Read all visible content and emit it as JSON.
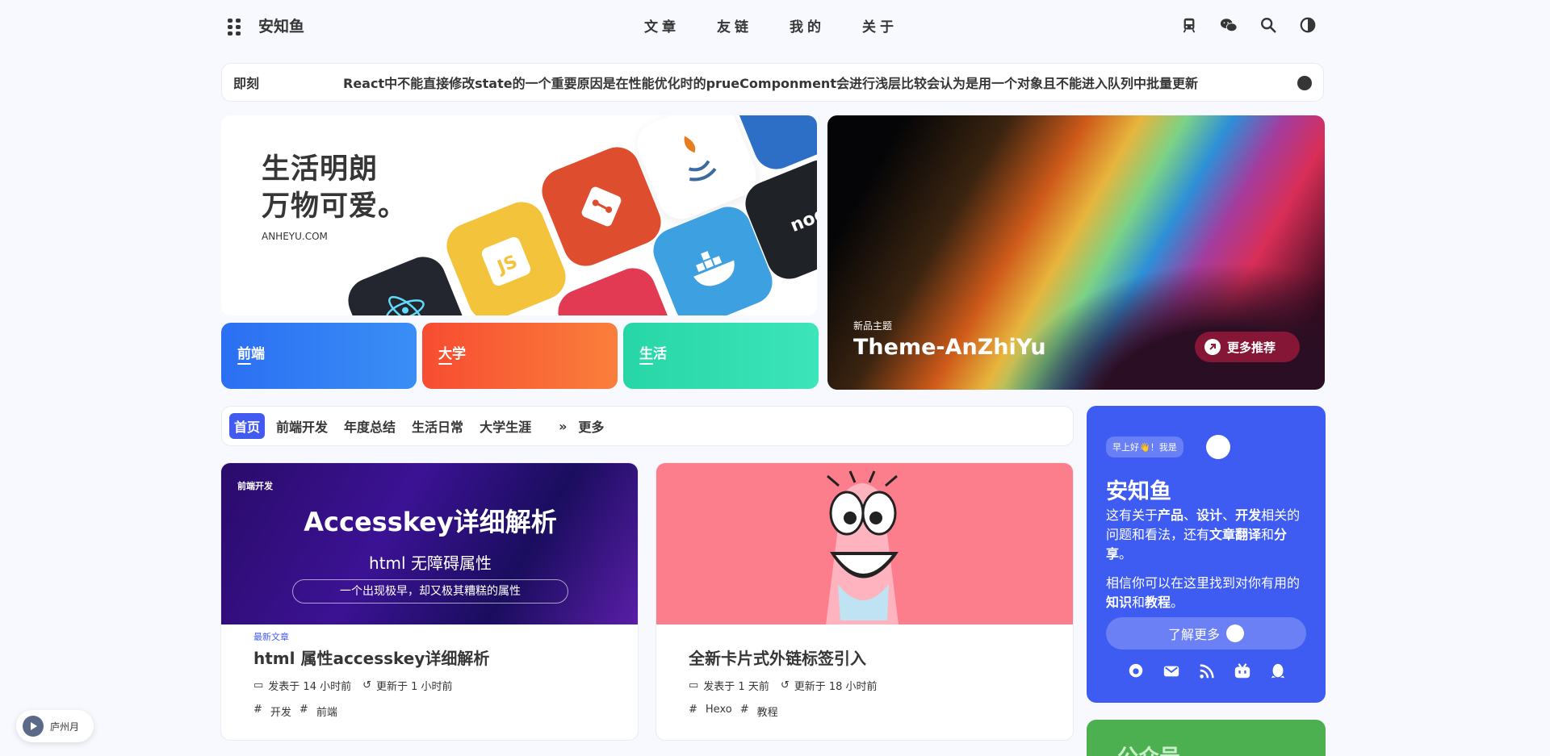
{
  "nav": {
    "site_title": "安知鱼",
    "menu": [
      "文章",
      "友链",
      "我的",
      "关于"
    ],
    "icons": [
      "menu-grid-icon",
      "train-icon",
      "wechat-icon",
      "search-icon",
      "contrast-icon"
    ]
  },
  "newsbar": {
    "label": "即刻",
    "text": "React中不能直接修改state的一个重要原因是在性能优化时的prueComponment会进行浅层比较会认为是用一个对象且不能进入队列中批量更新"
  },
  "hero": {
    "slogan_line1": "生活明朗",
    "slogan_line2": "万物可爱。",
    "site": "ANHEYU.COM",
    "categories": [
      {
        "label": "前端",
        "color": "#2b7bf3"
      },
      {
        "label": "大学",
        "color": "#f7572f"
      },
      {
        "label": "生活",
        "color": "#2fdcac"
      }
    ]
  },
  "featured": {
    "subtitle": "新品主题",
    "title": "Theme-AnZhiYu",
    "more_label": "更多推荐"
  },
  "tabs": {
    "items": [
      "首页",
      "前端开发",
      "年度总结",
      "生活日常",
      "大学生涯"
    ],
    "active": "首页",
    "more_label": "更多"
  },
  "posts": [
    {
      "cover_category": "前端开发",
      "cover_title": "Accesskey详细解析",
      "cover_subtitle": "html 无障碍属性",
      "cover_tagline": "一个出现极早，却又极其糟糕的属性",
      "badge": "最新文章",
      "title": "html 属性accesskey详细解析",
      "published": "发表于 14 小时前",
      "updated": "更新于 1 小时前",
      "tags": [
        "开发",
        "前端"
      ]
    },
    {
      "badge": "",
      "title": "全新卡片式外链标签引入",
      "published": "发表于 1 天前",
      "updated": "更新于 18 小时前",
      "tags": [
        "Hexo",
        "教程"
      ]
    }
  ],
  "author": {
    "greeting": "早上好👋！我是",
    "name": "安知鱼",
    "desc_parts": [
      "这有关于",
      "产品",
      "、",
      "设计",
      "、",
      "开发",
      "相关的问题和看法，还有",
      "文章翻译",
      "和",
      "分享",
      "。"
    ],
    "desc2_parts": [
      "相信你可以在这里找到对你有用的",
      "知识",
      "和",
      "教程",
      "。"
    ],
    "learn_more": "了解更多",
    "socials": [
      "github-icon",
      "mail-icon",
      "rss-icon",
      "bilibili-icon",
      "qq-icon"
    ]
  },
  "wechat_card_title": "公众号",
  "music": {
    "title": "庐州月"
  },
  "colors": {
    "accent": "#425aef",
    "author_card": "#3e5bf2"
  }
}
